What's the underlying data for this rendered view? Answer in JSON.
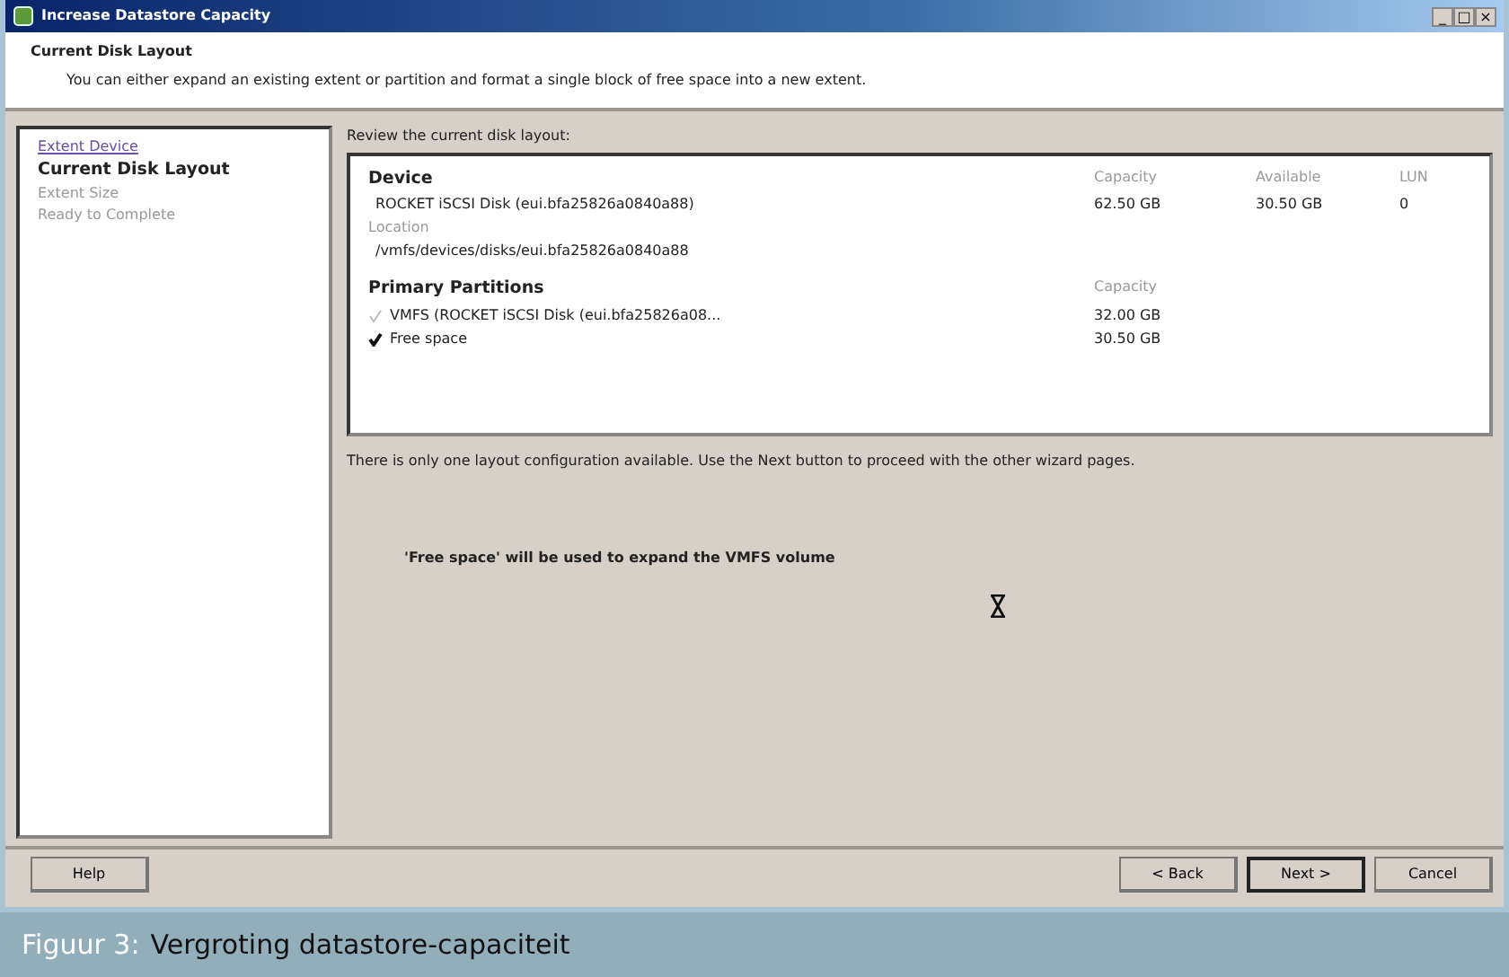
{
  "window": {
    "title": "Increase Datastore Capacity",
    "controls": [
      "_",
      "□",
      "×"
    ]
  },
  "header": {
    "title": "Current Disk Layout",
    "subtitle": "You can either expand an existing extent or partition and format a single block of free space into a new extent."
  },
  "steps": [
    {
      "label": "Extent Device",
      "kind": "link"
    },
    {
      "label": "Current Disk Layout",
      "kind": "current"
    },
    {
      "label": "Extent Size",
      "kind": "disabled"
    },
    {
      "label": "Ready to Complete",
      "kind": "disabled"
    }
  ],
  "review_label": "Review the current disk layout:",
  "device": {
    "heading": "Device",
    "name": "ROCKET iSCSI Disk (eui.bfa25826a0840a88)",
    "columns": [
      "Capacity",
      "Available",
      "LUN"
    ],
    "values": [
      "62.50 GB",
      "30.50 GB",
      "0"
    ],
    "location_label": "Location",
    "location": "/vmfs/devices/disks/eui.bfa25826a0840a88"
  },
  "partitions": {
    "heading": "Primary Partitions",
    "column": "Capacity",
    "rows": [
      {
        "name": "VMFS (ROCKET iSCSI Disk (eui.bfa25826a08...",
        "capacity": "32.00 GB",
        "selected": false
      },
      {
        "name": "Free space",
        "capacity": "30.50 GB",
        "selected": true
      }
    ]
  },
  "info": "There is only one layout configuration available. Use the Next button to proceed with the other wizard pages.",
  "summary": "'Free space' will be used to expand the VMFS volume",
  "buttons": {
    "left": [
      "Help"
    ],
    "right": [
      {
        "label": "< Back",
        "default": false
      },
      {
        "label": "Next >",
        "default": true
      },
      {
        "label": "Cancel",
        "default": false
      }
    ]
  },
  "caption": {
    "label": "Figuur 3:",
    "text": "Vergroting datastore-capaciteit"
  }
}
